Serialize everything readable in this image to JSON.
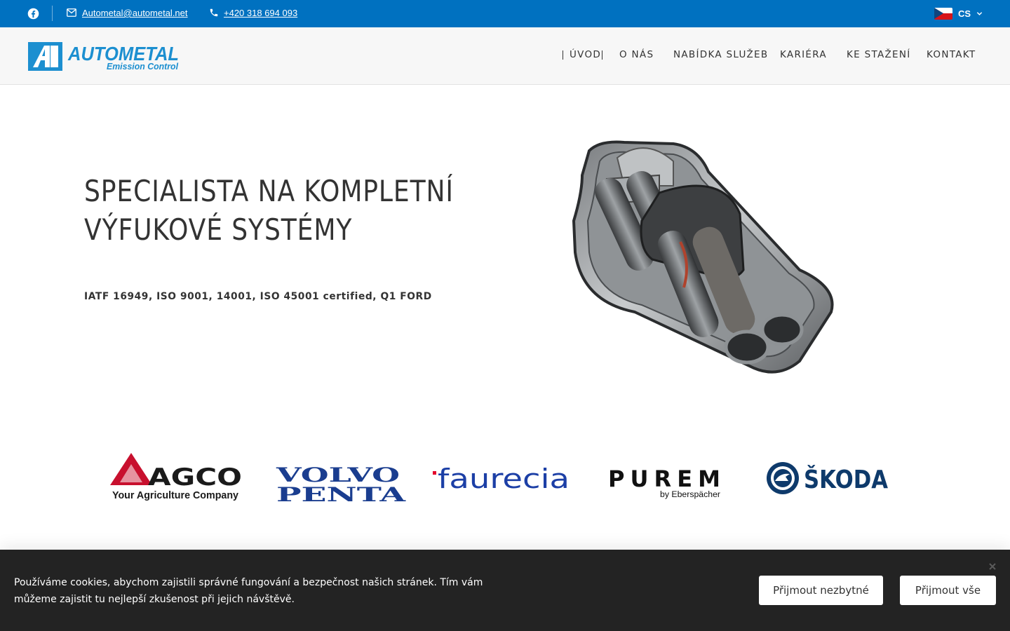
{
  "topbar": {
    "email": "Autometal@autometal.net",
    "phone": "+420 318 694 093",
    "language": "CS",
    "icons": [
      "facebook-icon",
      "mail-icon",
      "phone-icon",
      "flag-cz-icon",
      "chevron-down-icon"
    ],
    "background_color": "#0071c0"
  },
  "header": {
    "logo_main": "AUTOMETAL",
    "logo_sub": "Emission Control",
    "logo_mark": "A",
    "nav": [
      {
        "label": "ÚVOD",
        "active": true
      },
      {
        "label": "O NÁS"
      },
      {
        "label": "NABÍDKA SLUŽEB"
      },
      {
        "label": "KARIÉRA"
      },
      {
        "label": "KE STAŽENÍ"
      },
      {
        "label": "KONTAKT"
      }
    ]
  },
  "hero": {
    "title_line1": "SPECIALISTA NA KOMPLETNÍ",
    "title_line2": "VÝFUKOVÉ SYSTÉMY",
    "subtitle": "IATF 16949, ISO 9001, 14001, ISO 45001 certified, Q1 FORD"
  },
  "brands": {
    "agco": {
      "name": "AGCO",
      "tagline": "Your Agriculture Company"
    },
    "volvo": {
      "line1": "VOLVO",
      "line2": "PENTA"
    },
    "faurecia": {
      "name": "faurecia"
    },
    "purem": {
      "name": "PUREM",
      "tagline": "by Eberspächer"
    },
    "skoda": {
      "name": "ŠKODA"
    }
  },
  "cookie": {
    "text": "Používáme cookies, abychom zajistili správné fungování a bezpečnost našich stránek. Tím vám můžeme zajistit tu nejlepší zkušenost při jejich návštěvě.",
    "accept_necessary": "Přijmout nezbytné",
    "accept_all": "Přijmout vše"
  }
}
